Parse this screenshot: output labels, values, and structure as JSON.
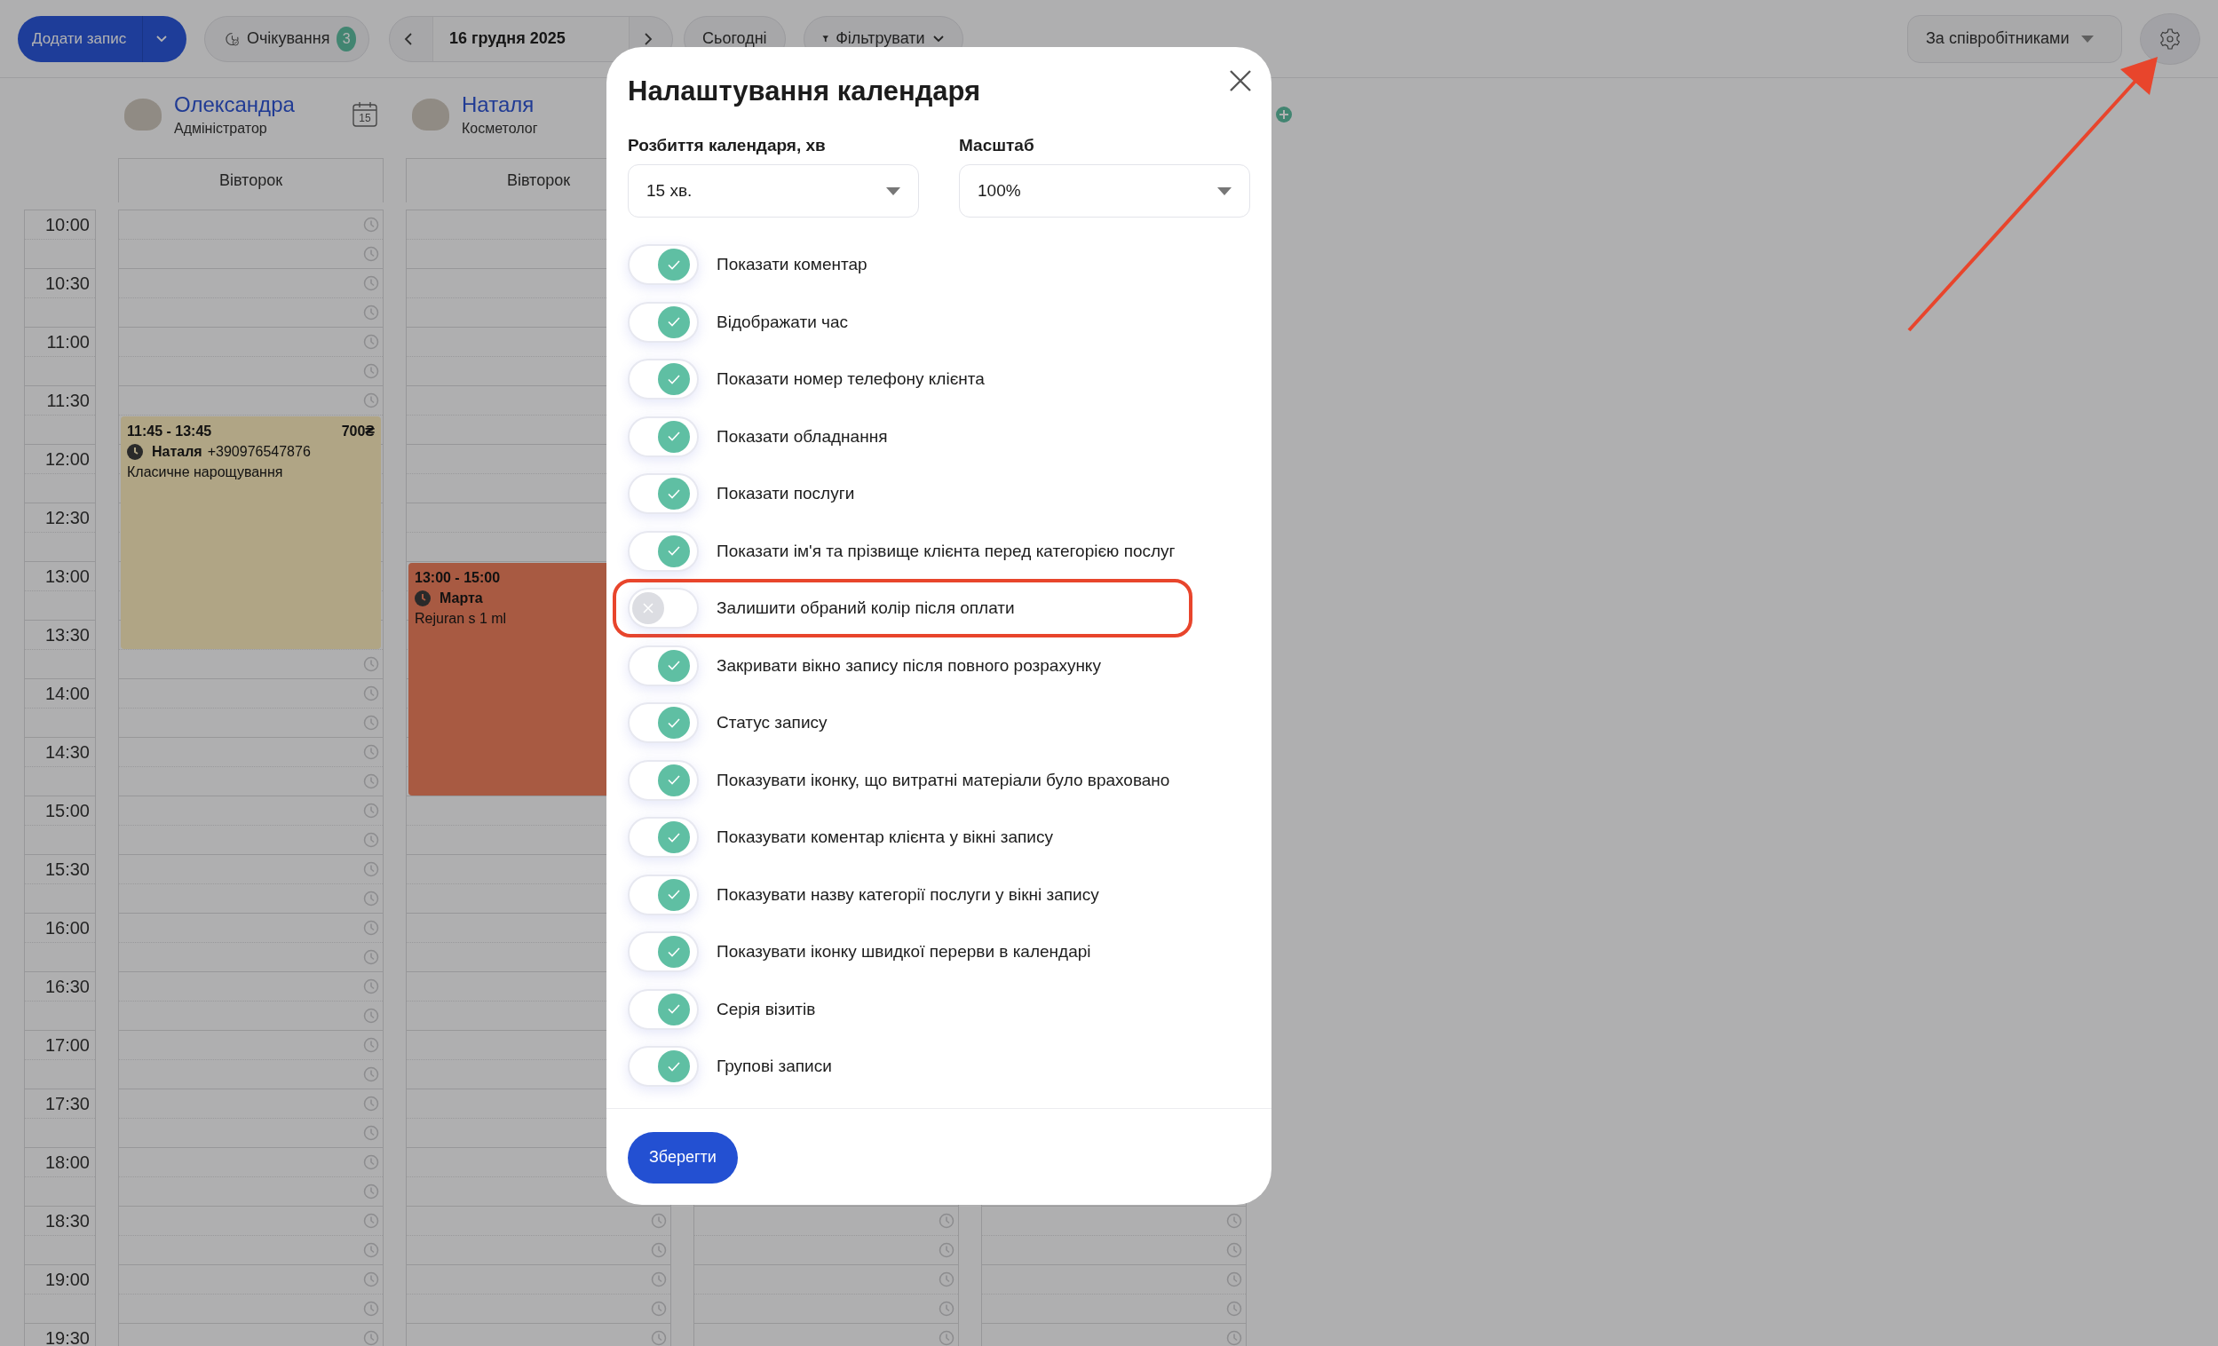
{
  "toolbar": {
    "add_button": "Додати запис",
    "waitlist": {
      "label": "Очікування",
      "count": "3"
    },
    "date": "16 грудня 2025",
    "today_button": "Сьогодні",
    "filter_button": "Фільтрувати",
    "view_select": "За співробітниками"
  },
  "time_labels": [
    "10:00",
    "10:30",
    "11:00",
    "11:30",
    "12:00",
    "12:30",
    "13:00",
    "13:30",
    "14:00",
    "14:30",
    "15:00",
    "15:30",
    "16:00",
    "16:30",
    "17:00",
    "17:30",
    "18:00",
    "18:30",
    "19:00",
    "19:30"
  ],
  "staff_columns": [
    {
      "name": "Олександра",
      "role": "Адміністратор",
      "calendar_day": "15",
      "day": "Вівторок",
      "appointments": [
        {
          "time": "11:45 - 13:45",
          "price": "700₴",
          "client": "Наталя",
          "phone": "+390976547876",
          "service": "Класичне нарощування",
          "color": "#b0a585"
        }
      ]
    },
    {
      "name": "Наталя",
      "role": "Косметолог",
      "day": "Вівторок",
      "appointments": [
        {
          "time": "13:00 - 15:00",
          "client": "Марта",
          "service": "Rejuran s 1 ml",
          "color": "#a85a42"
        }
      ]
    }
  ],
  "settings_dialog": {
    "title": "Налаштування календаря",
    "fields": [
      {
        "label": "Розбиття календаря, хв",
        "value": "15 хв."
      },
      {
        "label": "Масштаб",
        "value": "100%"
      }
    ],
    "options": [
      {
        "label": "Показати коментар",
        "on": true,
        "highlighted": false
      },
      {
        "label": "Відображати час",
        "on": true,
        "highlighted": false
      },
      {
        "label": "Показати номер телефону клієнта",
        "on": true,
        "highlighted": false
      },
      {
        "label": "Показати обладнання",
        "on": true,
        "highlighted": false
      },
      {
        "label": "Показати послуги",
        "on": true,
        "highlighted": false
      },
      {
        "label": "Показати ім'я та прізвище клієнта перед категорією послуг",
        "on": true,
        "highlighted": false
      },
      {
        "label": "Залишити обраний колір після оплати",
        "on": false,
        "highlighted": true
      },
      {
        "label": "Закривати вікно запису після повного розрахунку",
        "on": true,
        "highlighted": false
      },
      {
        "label": "Статус запису",
        "on": true,
        "highlighted": false
      },
      {
        "label": "Показувати іконку, що витратні матеріали було враховано",
        "on": true,
        "highlighted": false
      },
      {
        "label": "Показувати коментар клієнта у вікні запису",
        "on": true,
        "highlighted": false
      },
      {
        "label": "Показувати назву категорії послуги у вікні запису",
        "on": true,
        "highlighted": false
      },
      {
        "label": "Показувати іконку швидкої перерви в календарі",
        "on": true,
        "highlighted": false
      },
      {
        "label": "Серія візитів",
        "on": true,
        "highlighted": false
      },
      {
        "label": "Групові записи",
        "on": true,
        "highlighted": false
      }
    ],
    "save_button": "Зберегти"
  }
}
